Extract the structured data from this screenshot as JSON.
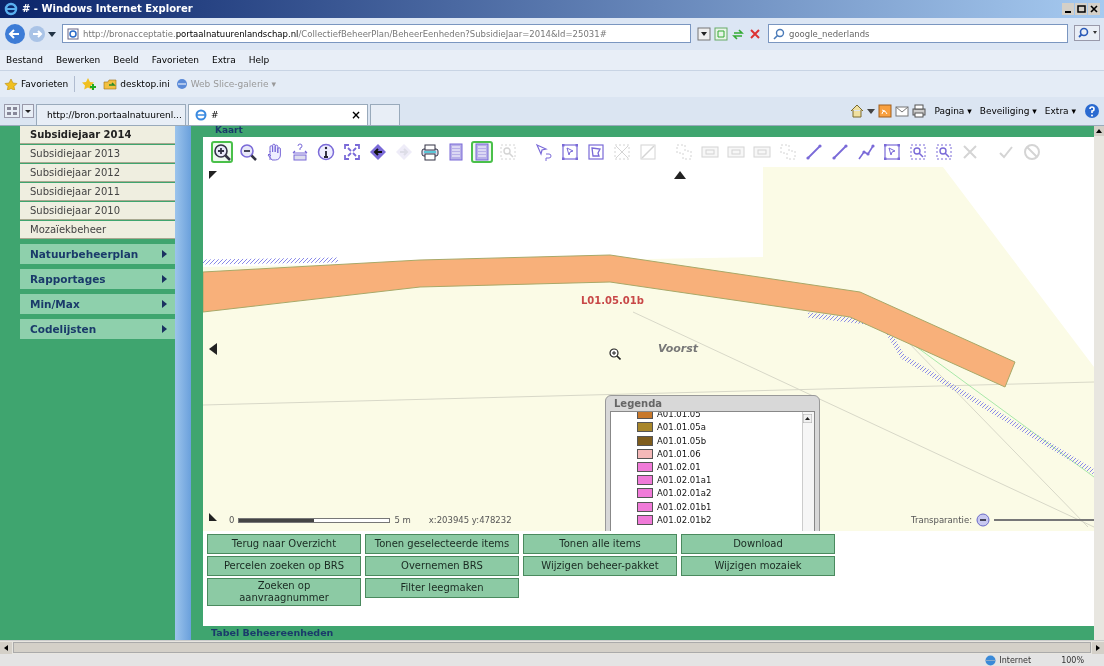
{
  "window": {
    "title": "# - Windows Internet Explorer"
  },
  "address_bar": {
    "url": "http://bronacceptatie.**portaalnatuurenlandschap.nl**/CollectiefBeheerPlan/BeheerEenheden?SubsidieJaar=2014&Id=25031#",
    "search_placeholder": "google_nederlands"
  },
  "menu": [
    "Bestand",
    "Bewerken",
    "Beeld",
    "Favorieten",
    "Extra",
    "Help"
  ],
  "favorites_bar": {
    "favorites": "Favorieten",
    "items": [
      {
        "label": "desktop.ini",
        "disabled": false
      },
      {
        "label": "Web Slice-galerie ▾",
        "disabled": true
      }
    ]
  },
  "tabs": [
    {
      "label": "http://bron.portaalnatuurenl...",
      "selected": false
    },
    {
      "label": "#",
      "selected": true
    }
  ],
  "tab_close": "×",
  "command_bar": [
    "Pagina ▾",
    "Beveiliging ▾",
    "Extra ▾"
  ],
  "sidebar": {
    "items": [
      {
        "label": "Subsidiejaar 2014",
        "selected": true
      },
      {
        "label": "Subsidiejaar 2013",
        "selected": false
      },
      {
        "label": "Subsidiejaar 2012",
        "selected": false
      },
      {
        "label": "Subsidiejaar 2011",
        "selected": false
      },
      {
        "label": "Subsidiejaar 2010",
        "selected": false
      },
      {
        "label": "Mozaïekbeheer",
        "selected": false
      }
    ],
    "groups": [
      "Natuurbeheerplan",
      "Rapportages",
      "Min/Max",
      "Codelijsten"
    ]
  },
  "map_panel": {
    "title": "Kaart",
    "tool_groups": [
      [
        {
          "kind": "zoomin",
          "selected": true,
          "disabled": false
        },
        {
          "kind": "zoomout",
          "selected": false,
          "disabled": false
        },
        {
          "kind": "hand",
          "selected": false,
          "disabled": false
        },
        {
          "kind": "query",
          "selected": false,
          "disabled": false
        },
        {
          "kind": "info",
          "selected": false,
          "disabled": false
        },
        {
          "kind": "extent",
          "selected": false,
          "disabled": false
        },
        {
          "kind": "back",
          "selected": false,
          "disabled": false
        },
        {
          "kind": "forward",
          "selected": false,
          "disabled": true
        },
        {
          "kind": "printer",
          "selected": false,
          "disabled": false
        },
        {
          "kind": "page",
          "selected": false,
          "disabled": false
        },
        {
          "kind": "page",
          "selected": true,
          "disabled": false
        },
        {
          "kind": "zoombox",
          "selected": false,
          "disabled": true
        }
      ],
      [
        {
          "kind": "pointer",
          "selected": false,
          "disabled": false
        },
        {
          "kind": "selectbox",
          "selected": false,
          "disabled": false
        },
        {
          "kind": "selectpoly",
          "selected": false,
          "disabled": false
        },
        {
          "kind": "cut",
          "selected": false,
          "disabled": true
        },
        {
          "kind": "edit",
          "selected": false,
          "disabled": true
        }
      ],
      [
        {
          "kind": "dashbox",
          "selected": false,
          "disabled": true
        },
        {
          "kind": "frame",
          "selected": false,
          "disabled": true
        },
        {
          "kind": "frame",
          "selected": false,
          "disabled": true
        },
        {
          "kind": "frame",
          "selected": false,
          "disabled": true
        },
        {
          "kind": "dashbox",
          "selected": false,
          "disabled": true
        },
        {
          "kind": "line",
          "selected": false,
          "disabled": false
        },
        {
          "kind": "line",
          "selected": false,
          "disabled": false
        },
        {
          "kind": "polyline",
          "selected": false,
          "disabled": false
        },
        {
          "kind": "selectbox",
          "selected": false,
          "disabled": false
        },
        {
          "kind": "zoombox",
          "selected": false,
          "disabled": false
        },
        {
          "kind": "zoombox",
          "selected": false,
          "disabled": false
        },
        {
          "kind": "cross",
          "selected": false,
          "disabled": true
        }
      ],
      [
        {
          "kind": "check",
          "selected": false,
          "disabled": true
        },
        {
          "kind": "forbid",
          "selected": false,
          "disabled": true
        }
      ]
    ],
    "feature_label": "L01.05.01b",
    "place_label": "Voorst",
    "scale": {
      "start": "0",
      "end": "5 m"
    },
    "coordinates": "x:203945 y:478232",
    "transparency_label": "Transparantie:",
    "legend": {
      "title": "Legenda",
      "items": [
        {
          "label": "A01.01.05",
          "color": "#c8782a"
        },
        {
          "label": "A01.01.05a",
          "color": "#a8862a"
        },
        {
          "label": "A01.01.05b",
          "color": "#7e5c1c"
        },
        {
          "label": "A01.01.06",
          "color": "#f4b8b8"
        },
        {
          "label": "A01.02.01",
          "color": "#f07ad8"
        },
        {
          "label": "A01.02.01a1",
          "color": "#f07ad8"
        },
        {
          "label": "A01.02.01a2",
          "color": "#f07ad8"
        },
        {
          "label": "A01.02.01b1",
          "color": "#f07ad8"
        },
        {
          "label": "A01.02.01b2",
          "color": "#f07ad8"
        }
      ]
    }
  },
  "action_buttons": [
    [
      "Terug naar Overzicht",
      "Tonen geselecteerde items",
      "Tonen alle items",
      "Download"
    ],
    [
      "Percelen zoeken op BRS",
      "Overnemen BRS",
      "Wijzigen beheer-pakket",
      "Wijzigen mozaiek"
    ],
    [
      "Zoeken op aanvraagnummer",
      "Filter leegmaken"
    ]
  ],
  "table_header": "Tabel Beheereenheden",
  "status_bar": {
    "zone": "Internet",
    "zoom": "100%"
  }
}
